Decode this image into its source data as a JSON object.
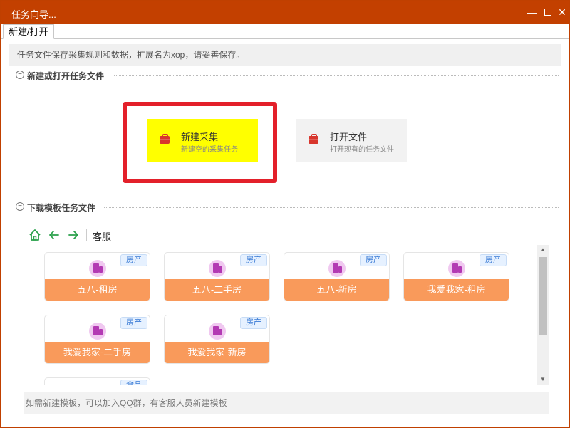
{
  "window": {
    "title": "任务向导...",
    "accent_color": "#c34000"
  },
  "tabs": [
    {
      "label": "新建/打开",
      "active": true
    }
  ],
  "info_text": "任务文件保存采集规则和数据，扩展名为xop，请妥善保存。",
  "section_new_open": {
    "toggle_symbol": "⊖",
    "title": "新建或打开任务文件",
    "new_card": {
      "title": "新建采集",
      "subtitle": "新建空的采集任务",
      "icon": "briefcase-icon",
      "background": "#ffff00"
    },
    "open_card": {
      "title": "打开文件",
      "subtitle": "打开现有的任务文件",
      "icon": "briefcase-icon"
    }
  },
  "section_templates": {
    "toggle_symbol": "⊖",
    "title": "下载模板任务文件",
    "nav": {
      "location": "客服",
      "icons": [
        "home-icon",
        "back-arrow-icon",
        "forward-arrow-icon"
      ]
    },
    "templates": [
      {
        "category": "房产",
        "name": "五八-租房"
      },
      {
        "category": "房产",
        "name": "五八-二手房"
      },
      {
        "category": "房产",
        "name": "五八-新房"
      },
      {
        "category": "房产",
        "name": "我爱我家-租房"
      },
      {
        "category": "房产",
        "name": "我爱我家-二手房"
      },
      {
        "category": "房产",
        "name": "我爱我家-新房"
      },
      {
        "category": "食品",
        "name": ""
      }
    ],
    "card_color": "#f99a5b",
    "badge_color": "#3a7bd5"
  },
  "footer_note": "如需新建模板，可以加入QQ群，有客服人员新建模板"
}
